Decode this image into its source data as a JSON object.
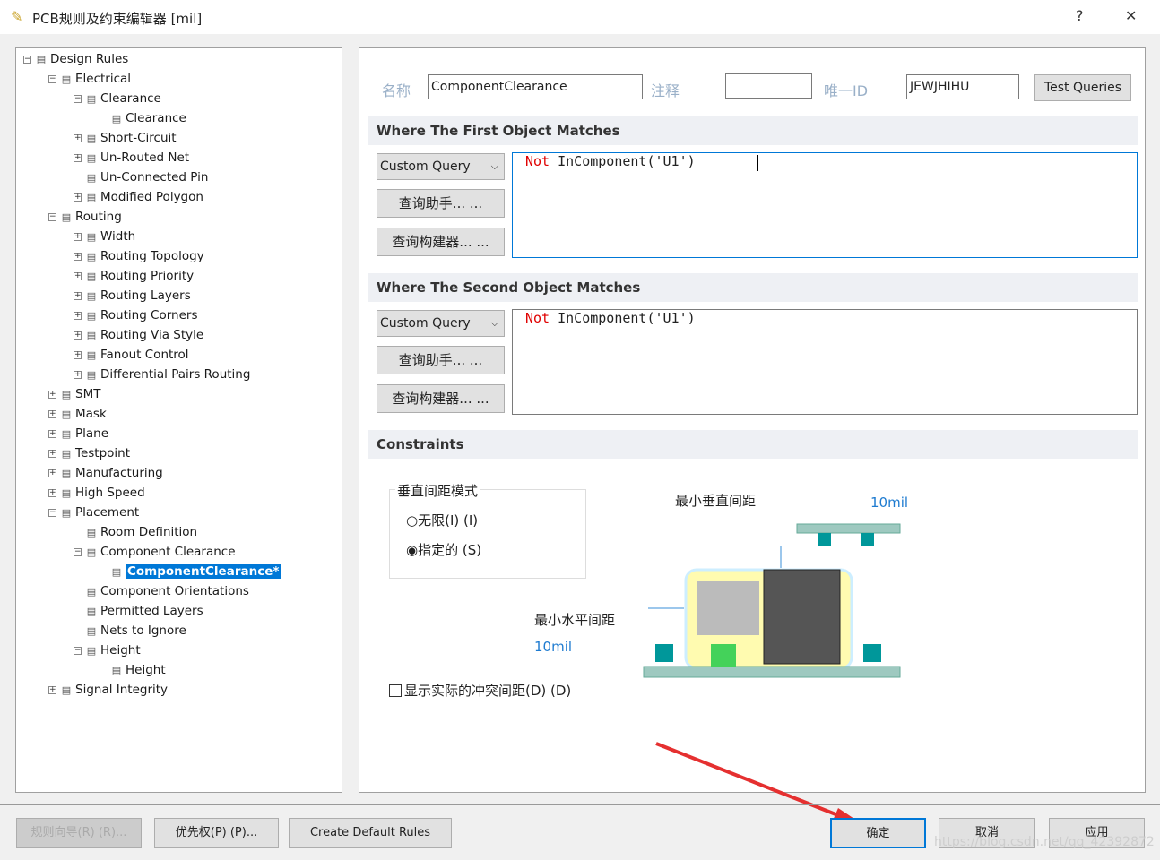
{
  "window": {
    "title": "PCB规则及约束编辑器 [mil]",
    "help": "?",
    "close": "✕"
  },
  "tree": [
    {
      "label": "Design Rules",
      "level": 0,
      "ex": "-"
    },
    {
      "label": "Electrical",
      "level": 1,
      "ex": "-"
    },
    {
      "label": "Clearance",
      "level": 2,
      "ex": "-"
    },
    {
      "label": "Clearance",
      "level": 3,
      "ex": ""
    },
    {
      "label": "Short-Circuit",
      "level": 2,
      "ex": "+"
    },
    {
      "label": "Un-Routed Net",
      "level": 2,
      "ex": "+"
    },
    {
      "label": "Un-Connected Pin",
      "level": 2,
      "ex": ""
    },
    {
      "label": "Modified Polygon",
      "level": 2,
      "ex": "+"
    },
    {
      "label": "Routing",
      "level": 1,
      "ex": "-"
    },
    {
      "label": "Width",
      "level": 2,
      "ex": "+"
    },
    {
      "label": "Routing Topology",
      "level": 2,
      "ex": "+"
    },
    {
      "label": "Routing Priority",
      "level": 2,
      "ex": "+"
    },
    {
      "label": "Routing Layers",
      "level": 2,
      "ex": "+"
    },
    {
      "label": "Routing Corners",
      "level": 2,
      "ex": "+"
    },
    {
      "label": "Routing Via Style",
      "level": 2,
      "ex": "+"
    },
    {
      "label": "Fanout Control",
      "level": 2,
      "ex": "+"
    },
    {
      "label": "Differential Pairs Routing",
      "level": 2,
      "ex": "+"
    },
    {
      "label": "SMT",
      "level": 1,
      "ex": "+"
    },
    {
      "label": "Mask",
      "level": 1,
      "ex": "+"
    },
    {
      "label": "Plane",
      "level": 1,
      "ex": "+"
    },
    {
      "label": "Testpoint",
      "level": 1,
      "ex": "+"
    },
    {
      "label": "Manufacturing",
      "level": 1,
      "ex": "+"
    },
    {
      "label": "High Speed",
      "level": 1,
      "ex": "+"
    },
    {
      "label": "Placement",
      "level": 1,
      "ex": "-"
    },
    {
      "label": "Room Definition",
      "level": 2,
      "ex": ""
    },
    {
      "label": "Component Clearance",
      "level": 2,
      "ex": "-"
    },
    {
      "label": "ComponentClearance*",
      "level": 3,
      "ex": "",
      "selected": true
    },
    {
      "label": "Component Orientations",
      "level": 2,
      "ex": ""
    },
    {
      "label": "Permitted Layers",
      "level": 2,
      "ex": ""
    },
    {
      "label": "Nets to Ignore",
      "level": 2,
      "ex": ""
    },
    {
      "label": "Height",
      "level": 2,
      "ex": "-"
    },
    {
      "label": "Height",
      "level": 3,
      "ex": ""
    },
    {
      "label": "Signal Integrity",
      "level": 1,
      "ex": "+"
    }
  ],
  "form": {
    "name_label": "名称",
    "name_value": "ComponentClearance",
    "comment_label": "注释",
    "comment_value": "",
    "id_label": "唯一ID",
    "id_value": "JEWJHIHU",
    "test_queries": "Test Queries"
  },
  "first": {
    "title": "Where The First Object Matches",
    "query_type": "Custom Query",
    "helper": "查询助手... ...",
    "builder": "查询构建器... ...",
    "kw": "Not",
    "expr": " InComponent('U1')"
  },
  "second": {
    "title": "Where The Second Object Matches",
    "query_type": "Custom Query",
    "helper": "查询助手... ...",
    "builder": "查询构建器... ...",
    "kw": "Not",
    "expr": " InComponent('U1')"
  },
  "constraints": {
    "title": "Constraints",
    "mode_group": "垂直间距模式",
    "opt_infinite": "无限(I) (I)",
    "opt_specified": "指定的 (S)",
    "selected": "specified",
    "min_vertical_label": "最小垂直间距",
    "min_vertical_value": "10mil",
    "min_horizontal_label": "最小水平间距",
    "min_horizontal_value": "10mil",
    "show_actual": "显示实际的冲突间距(D) (D)",
    "show_actual_checked": false
  },
  "footer": {
    "wizard": "规则向导(R) (R)...",
    "priority": "优先权(P) (P)...",
    "create_default": "Create Default Rules",
    "ok": "确定",
    "cancel": "取消",
    "apply": "应用"
  },
  "watermark": "https://blog.csdn.net/qq_42392872"
}
